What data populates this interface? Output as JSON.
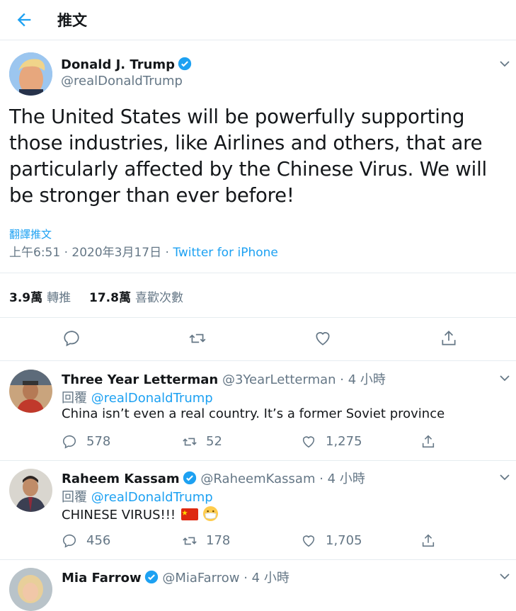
{
  "header": {
    "title": "推文"
  },
  "tweet": {
    "author_name": "Donald J. Trump",
    "author_handle": "@realDonaldTrump",
    "text": "The United States will be powerfully supporting those industries, like Airlines and others, that are particularly affected by the Chinese Virus. We will be stronger than ever before!",
    "translate_label": "翻譯推文",
    "time": "上午6:51 · 2020年3月17日 · ",
    "source": "Twitter for iPhone",
    "retweets_count": "3.9萬",
    "retweets_label": "轉推",
    "likes_count": "17.8萬",
    "likes_label": "喜歡次數"
  },
  "replies": [
    {
      "name": "Three Year Letterman",
      "handle": "@3YearLetterman",
      "time": "· 4 小時",
      "reply_to_label": "回覆",
      "reply_to_handle": "@realDonaldTrump",
      "text": "China isn’t even a real country. It’s a former Soviet province",
      "replies": "578",
      "retweets": "52",
      "likes": "1,275",
      "verified": false
    },
    {
      "name": "Raheem Kassam",
      "handle": "@RaheemKassam",
      "time": "· 4 小時",
      "reply_to_label": "回覆",
      "reply_to_handle": "@realDonaldTrump",
      "text": "CHINESE VIRUS!!!",
      "replies": "456",
      "retweets": "178",
      "likes": "1,705",
      "verified": true
    },
    {
      "name": "Mia Farrow",
      "handle": "@MiaFarrow",
      "time": "· 4 小時",
      "verified": true
    }
  ],
  "colors": {
    "accent": "#1da1f2",
    "muted": "#657786",
    "border": "#e6ecf0",
    "text": "#14171a"
  },
  "icons": [
    "back-arrow-icon",
    "verified-badge-icon",
    "chevron-down-icon",
    "reply-icon",
    "retweet-icon",
    "like-icon",
    "share-icon",
    "china-flag-emoji",
    "mask-face-emoji"
  ]
}
